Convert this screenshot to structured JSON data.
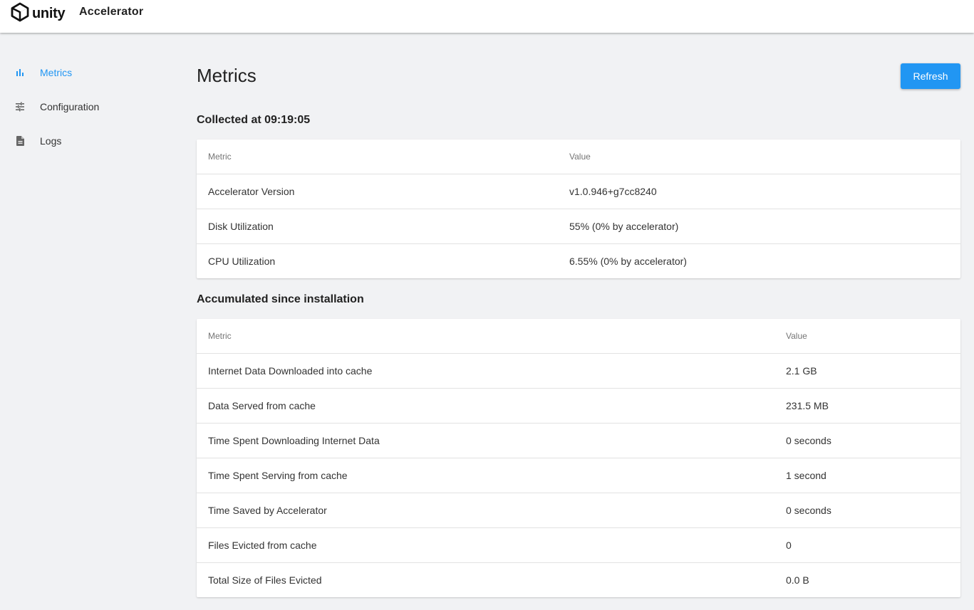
{
  "header": {
    "brand": "unity",
    "app_title": "Accelerator"
  },
  "sidebar": {
    "items": [
      {
        "label": "Metrics",
        "icon": "bar-chart-icon",
        "active": true
      },
      {
        "label": "Configuration",
        "icon": "sliders-icon",
        "active": false
      },
      {
        "label": "Logs",
        "icon": "document-icon",
        "active": false
      }
    ]
  },
  "main": {
    "title": "Metrics",
    "refresh_label": "Refresh",
    "collected": {
      "title": "Collected at 09:19:05",
      "columns": [
        "Metric",
        "Value"
      ],
      "rows": [
        {
          "metric": "Accelerator Version",
          "value": "v1.0.946+g7cc8240"
        },
        {
          "metric": "Disk Utilization",
          "value": "55% (0% by accelerator)"
        },
        {
          "metric": "CPU Utilization",
          "value": "6.55% (0% by accelerator)"
        }
      ]
    },
    "accumulated": {
      "title": "Accumulated since installation",
      "columns": [
        "Metric",
        "Value"
      ],
      "rows": [
        {
          "metric": "Internet Data Downloaded into cache",
          "value": "2.1 GB"
        },
        {
          "metric": "Data Served from cache",
          "value": "231.5 MB"
        },
        {
          "metric": "Time Spent Downloading Internet Data",
          "value": "0 seconds"
        },
        {
          "metric": "Time Spent Serving from cache",
          "value": "1 second"
        },
        {
          "metric": "Time Saved by Accelerator",
          "value": "0 seconds"
        },
        {
          "metric": "Files Evicted from cache",
          "value": "0"
        },
        {
          "metric": "Total Size of Files Evicted",
          "value": "0.0 B"
        }
      ]
    }
  },
  "colors": {
    "accent": "#2196f3",
    "background": "#f1f2f4",
    "card": "#ffffff"
  }
}
